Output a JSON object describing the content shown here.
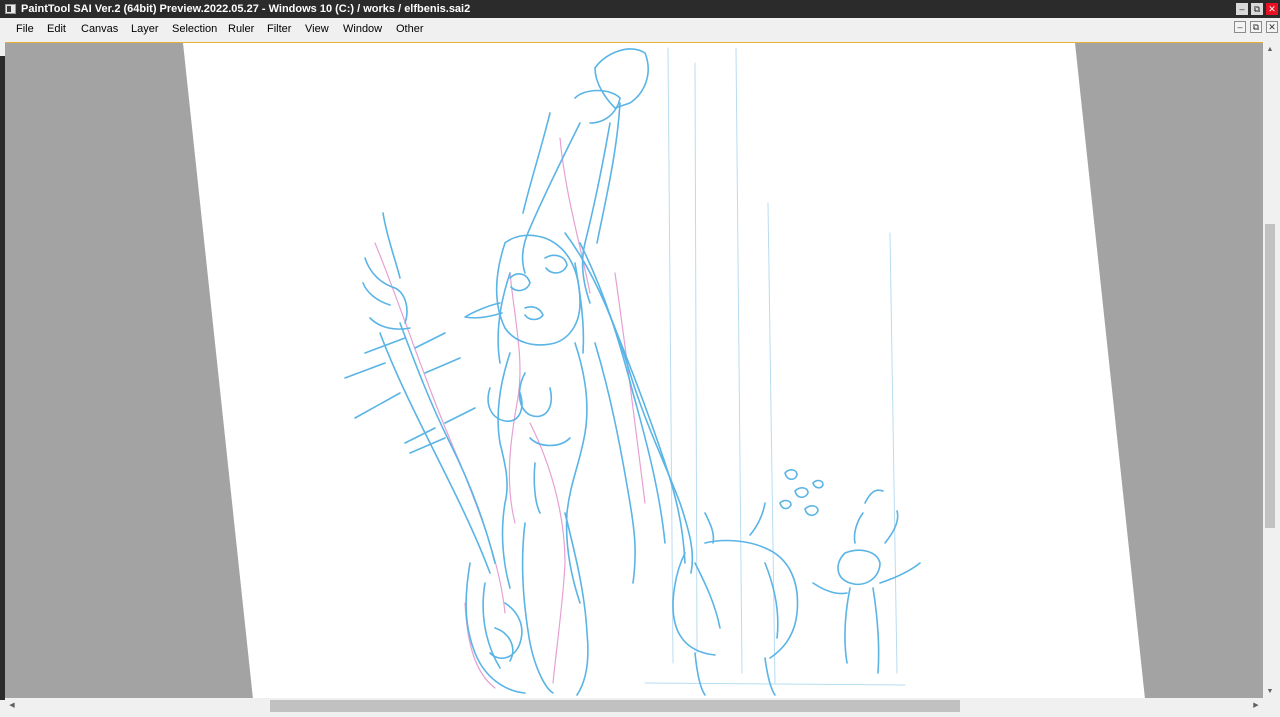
{
  "window": {
    "title": "PaintTool SAI Ver.2 (64bit) Preview.2022.05.27 - Windows 10 (C:) / works / elfbenis.sai2",
    "minimize_glyph": "–",
    "maximize_glyph": "⧉",
    "close_glyph": "✕"
  },
  "menu": {
    "items": [
      "File",
      "Edit",
      "Canvas",
      "Layer",
      "Selection",
      "Ruler",
      "Filter",
      "View",
      "Window",
      "Other"
    ]
  },
  "document_controls": {
    "minimize_glyph": "–",
    "restore_glyph": "⧉",
    "close_glyph": "✕"
  },
  "scrollbars": {
    "up_glyph": "▲",
    "down_glyph": "▼",
    "left_glyph": "◀",
    "right_glyph": "▶"
  },
  "colors": {
    "titlebar": "#2b2b2b",
    "canvas_background": "#a3a3a3",
    "paper": "#ffffff",
    "sketch_blue": "#5ab4e6",
    "sketch_pink": "#e6a0d2"
  },
  "icons": {
    "app": "painttool-sai-icon"
  }
}
